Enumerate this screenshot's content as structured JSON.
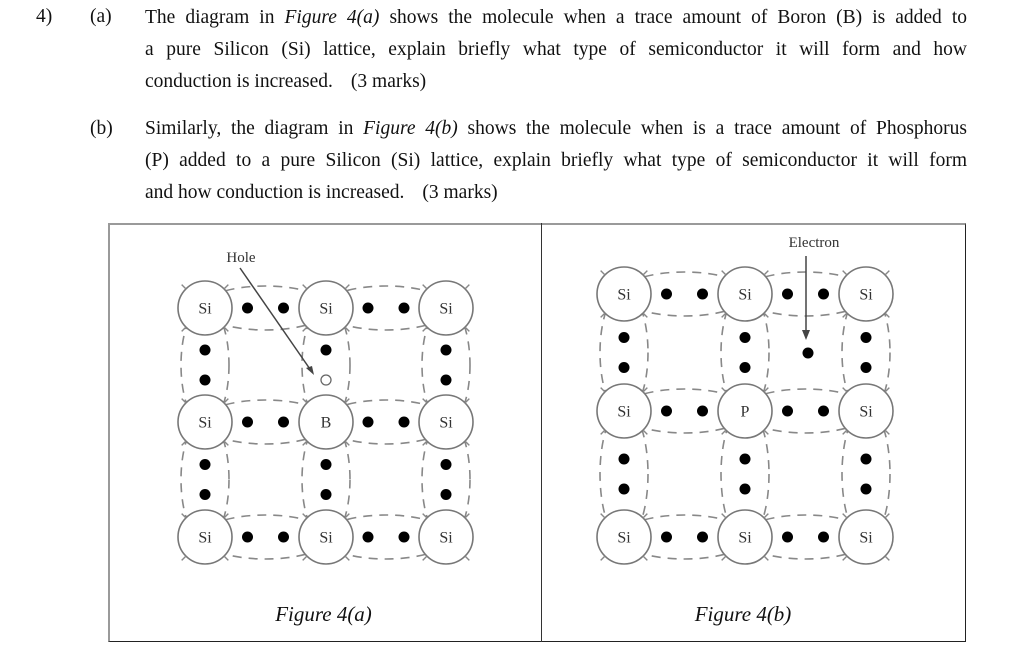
{
  "question": {
    "number": "4)",
    "parts": [
      {
        "label": "(a)",
        "lines": [
          [
            {
              "t": "The diagram in "
            },
            {
              "t": "Figure 4(a)",
              "i": true
            },
            {
              "t": " shows the molecule when a trace amount of Boron (B) is added to"
            }
          ],
          [
            {
              "t": "a pure Silicon (Si) lattice, explain briefly what type of semiconductor it will form and how"
            }
          ],
          [
            {
              "t": "conduction is increased."
            }
          ]
        ],
        "marks": "(3 marks)"
      },
      {
        "label": "(b)",
        "lines": [
          [
            {
              "t": "Similarly, the diagram in "
            },
            {
              "t": "Figure 4(b)",
              "i": true
            },
            {
              "t": " shows the molecule when is a trace amount of Phosphorus"
            }
          ],
          [
            {
              "t": "(P) added to a pure Silicon (Si) lattice, explain briefly what type of semiconductor it will form"
            }
          ],
          [
            {
              "t": "and how conduction is increased."
            }
          ]
        ],
        "marks": "(3 marks)"
      }
    ]
  },
  "figures": [
    {
      "id": "fig-a",
      "caption": "Figure 4(a)",
      "dopant": "B",
      "atoms": [
        [
          "Si",
          "Si",
          "Si"
        ],
        [
          "Si",
          "B",
          "Si"
        ],
        [
          "Si",
          "Si",
          "Si"
        ]
      ],
      "annotation": {
        "label": "Hole",
        "points_to": "hole between top-center Si and B"
      },
      "special": "hole"
    },
    {
      "id": "fig-b",
      "caption": "Figure 4(b)",
      "dopant": "P",
      "atoms": [
        [
          "Si",
          "Si",
          "Si"
        ],
        [
          "Si",
          "P",
          "Si"
        ],
        [
          "Si",
          "Si",
          "Si"
        ]
      ],
      "annotation": {
        "label": "Electron",
        "points_to": "extra free electron"
      },
      "special": "extra-electron"
    }
  ]
}
